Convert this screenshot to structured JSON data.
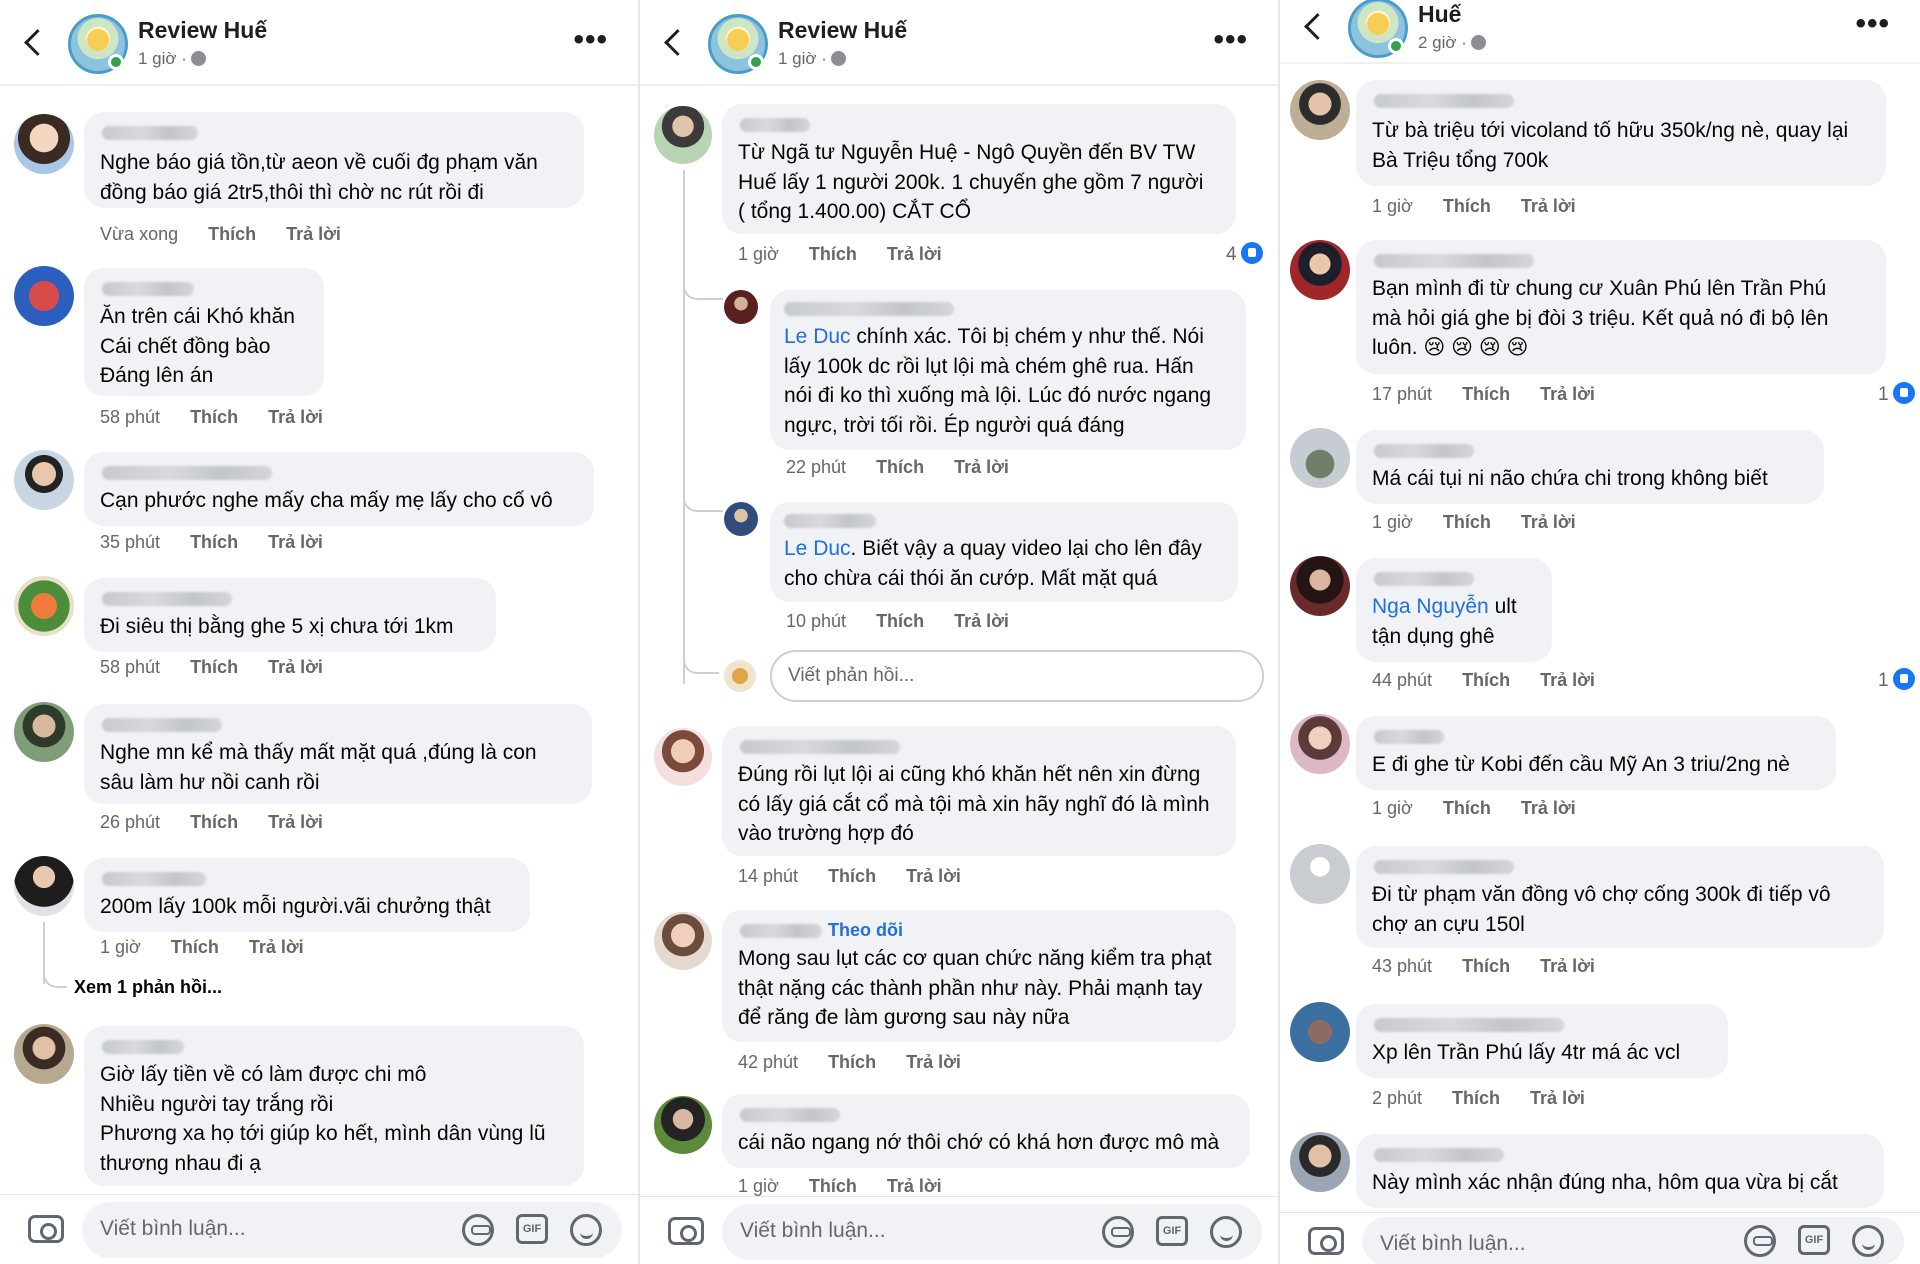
{
  "panels": [
    {
      "page_name": "Review Huế",
      "time": "1 giờ ·",
      "comment_placeholder": "Viết bình luận...",
      "comments": [
        {
          "text": "Nghe báo giá tồn,từ aeon về cuối đg phạm văn\nđồng báo giá 2tr5,thôi thì chờ nc rút rồi đi",
          "time": "Vừa xong",
          "like": "Thích",
          "reply": "Trả lời"
        },
        {
          "text": "Ăn trên cái Khó khăn\nCái chết đồng bào\nĐáng lên án",
          "time": "58 phút",
          "like": "Thích",
          "reply": "Trả lời"
        },
        {
          "text": "Cạn phước nghe mấy cha mấy mẹ lấy cho cố vô",
          "time": "35 phút",
          "like": "Thích",
          "reply": "Trả lời"
        },
        {
          "text": "Đi siêu thị bằng ghe 5 xị  chưa tới 1km",
          "time": "58 phút",
          "like": "Thích",
          "reply": "Trả lời"
        },
        {
          "text": "Nghe mn kể mà thấy mất mặt quá  ,đúng là con\nsâu làm hư nồi canh rồi",
          "time": "26 phút",
          "like": "Thích",
          "reply": "Trả lời"
        },
        {
          "text": "200m lấy 100k mỗi người.vãi chưởng thật",
          "time": "1 giờ",
          "like": "Thích",
          "reply": "Trả lời",
          "view_replies": "Xem 1 phản hồi..."
        },
        {
          "text": "Giờ lấy tiền về có làm được chi mô\nNhiều người tay trắng rồi\nPhương xa họ tới giúp ko hết, mình dân vùng lũ\nthương nhau đi ạ"
        }
      ]
    },
    {
      "page_name": "Review Huế",
      "time": "1 giờ ·",
      "comment_placeholder": "Viết bình luận...",
      "reply_placeholder": "Viết phản hồi...",
      "comments": [
        {
          "text": "Từ Ngã tư Nguyễn Huệ - Ngô Quyền đến BV TW\nHuế lấy 1 người 200k. 1 chuyến ghe gồm 7 người\n( tổng 1.400.00) CẮT CỔ",
          "time": "1 giờ",
          "like": "Thích",
          "reply": "Trả lời",
          "reactions": "4"
        },
        {
          "mention": "Le Duc",
          "text": " chính xác. Tôi bị chém y như thế. Nói\nlấy 100k dc rồi lụt lội mà chém ghê rua. Hấn\nnói đi ko thì xuống mà lội. Lúc đó nước ngang\nngực, trời tối rồi. Ép người quá đáng",
          "time": "22 phút",
          "like": "Thích",
          "reply": "Trả lời"
        },
        {
          "mention": "Le Duc",
          "text": ".  Biết vậy a quay video lại cho lên đây\ncho chừa cái thói ăn cướp. Mất mặt quá",
          "time": "10 phút",
          "like": "Thích",
          "reply": "Trả lời"
        },
        {
          "text": "Đúng rồi lụt lội ai cũng khó khăn hết nên xin đừng\ncó lấy giá cắt cổ mà tội mà xin hãy nghĩ đó là mình\nvào trường hợp đó",
          "time": "14 phút",
          "like": "Thích",
          "reply": "Trả lời"
        },
        {
          "follow": "Theo dõi",
          "text": "Mong sau lụt các cơ quan chức năng kiểm tra phạt\nthật nặng các thành phần như này. Phải mạnh tay\nđể răng đe làm gương sau này nữa",
          "time": "42 phút",
          "like": "Thích",
          "reply": "Trả lời"
        },
        {
          "text": "cái não ngang nớ thôi chớ có khá hơn được mô mà",
          "time": "1 giờ",
          "like": "Thích",
          "reply": "Trả lời"
        }
      ]
    },
    {
      "page_name": "Huế",
      "time": "2 giờ ·",
      "comment_placeholder": "Viết bình luận...",
      "comments": [
        {
          "text": "Từ bà triệu tới vicoland tố hữu 350k/ng nè, quay lại\nBà Triệu tổng 700k",
          "time": "1 giờ",
          "like": "Thích",
          "reply": "Trả lời"
        },
        {
          "text": "Bạn mình đi từ chung cư Xuân Phú lên Trần Phú\nmà hỏi giá ghe bị đòi 3 triệu. Kết quả nó đi bộ lên\nluôn. 😢 😢 😢 😢",
          "time": "17 phút",
          "like": "Thích",
          "reply": "Trả lời",
          "reactions": "1"
        },
        {
          "text": "Má cái tụi ni não chứa chi trong không biết",
          "time": "1 giờ",
          "like": "Thích",
          "reply": "Trả lời"
        },
        {
          "mention": "Nga Nguyễn",
          "text": " ult\ntận dụng ghê",
          "time": "44 phút",
          "like": "Thích",
          "reply": "Trả lời",
          "reactions": "1"
        },
        {
          "text": "E đi ghe từ Kobi đến cầu Mỹ An 3 triu/2ng nè",
          "time": "1 giờ",
          "like": "Thích",
          "reply": "Trả lời"
        },
        {
          "text": "Đi từ phạm văn đồng vô chợ cống 300k đi tiếp vô\nchợ an cựu 150l",
          "time": "43 phút",
          "like": "Thích",
          "reply": "Trả lời"
        },
        {
          "text": "Xp lên Trần Phú lấy 4tr má ác vcl",
          "time": "2 phút",
          "like": "Thích",
          "reply": "Trả lời"
        },
        {
          "text": "Này mình xác nhận đúng nha, hôm qua vừa bị cắt"
        }
      ]
    }
  ],
  "icons": {
    "camera": "camera-icon",
    "avatar_sticker": "avatar-sticker-icon",
    "gif": "GIF",
    "emoji": "emoji-icon"
  }
}
